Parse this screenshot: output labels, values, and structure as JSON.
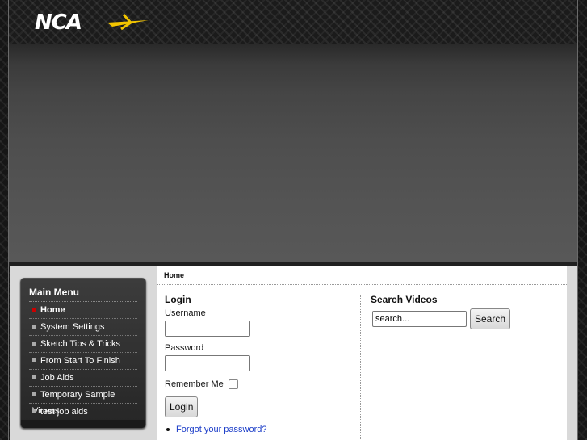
{
  "header": {
    "logo_text": "NCA"
  },
  "breadcrumb": "Home",
  "main_menu": {
    "title": "Main Menu",
    "items": [
      {
        "label": "Home",
        "active": true
      },
      {
        "label": "System Settings",
        "active": false
      },
      {
        "label": "Sketch Tips & Tricks",
        "active": false
      },
      {
        "label": "From Start To Finish",
        "active": false
      },
      {
        "label": "Job Aids",
        "active": false
      },
      {
        "label": "Temporary Sample Videos",
        "active": false
      },
      {
        "label": "test job aids",
        "active": false
      }
    ]
  },
  "login": {
    "title": "Login",
    "username_label": "Username",
    "username_value": "",
    "password_label": "Password",
    "password_value": "",
    "remember_label": "Remember Me",
    "login_button": "Login",
    "forgot_link": "Forgot your password?"
  },
  "search": {
    "title": "Search Videos",
    "input_value": "search...",
    "button_label": "Search"
  },
  "colors": {
    "active_bullet": "#cc0000",
    "link": "#1a3cc8",
    "logo_accent": "#f2c400"
  }
}
